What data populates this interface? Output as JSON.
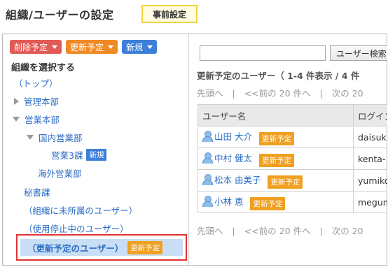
{
  "header": {
    "title": "組織/ユーザーの設定",
    "badge": "事前設定"
  },
  "left": {
    "actions": {
      "delete": "削除予定",
      "update": "更新予定",
      "new": "新規"
    },
    "select_title": "組織を選択する",
    "tree": {
      "top": "（トップ）",
      "admin": "管理本部",
      "sales": "営業本部",
      "domestic": "国内営業部",
      "sales3": "営業3課",
      "sales3_tag": "新規",
      "overseas": "海外営業部",
      "secretary": "秘書課",
      "unaffiliated": "（組織に未所属のユーザー）",
      "suspended": "（使用停止中のユーザー）",
      "scheduled": "（更新予定のユーザー）",
      "scheduled_tag": "更新予定"
    }
  },
  "right": {
    "search_value": "",
    "search_button": "ユーザー検索",
    "result_heading": "更新予定のユーザー（ 1-4 件表示 / 4 件",
    "pager": {
      "first": "先頭へ",
      "prev": "<<前の 20 件へ",
      "next": "次の 20"
    },
    "columns": [
      "ユーザー名",
      "ログイン"
    ],
    "rows": [
      {
        "name": "山田 大介",
        "tag": "更新予定",
        "login": "daisuk"
      },
      {
        "name": "中村 健太",
        "tag": "更新予定",
        "login": "kenta-"
      },
      {
        "name": "松本 由美子",
        "tag": "更新予定",
        "login": "yumiko"
      },
      {
        "name": "小林 恵",
        "tag": "更新予定",
        "login": "megum"
      }
    ]
  },
  "colors": {
    "delete": "#e25a55",
    "update": "#f08a24",
    "new": "#3d7fd9",
    "link": "#2b6cc4",
    "selected_bg": "#c8def5",
    "highlight_border": "#e03333",
    "badge_border": "#f0d23c"
  },
  "icons": [
    "user-icon",
    "chevron-down-icon",
    "triangle-right-icon",
    "triangle-down-icon"
  ]
}
